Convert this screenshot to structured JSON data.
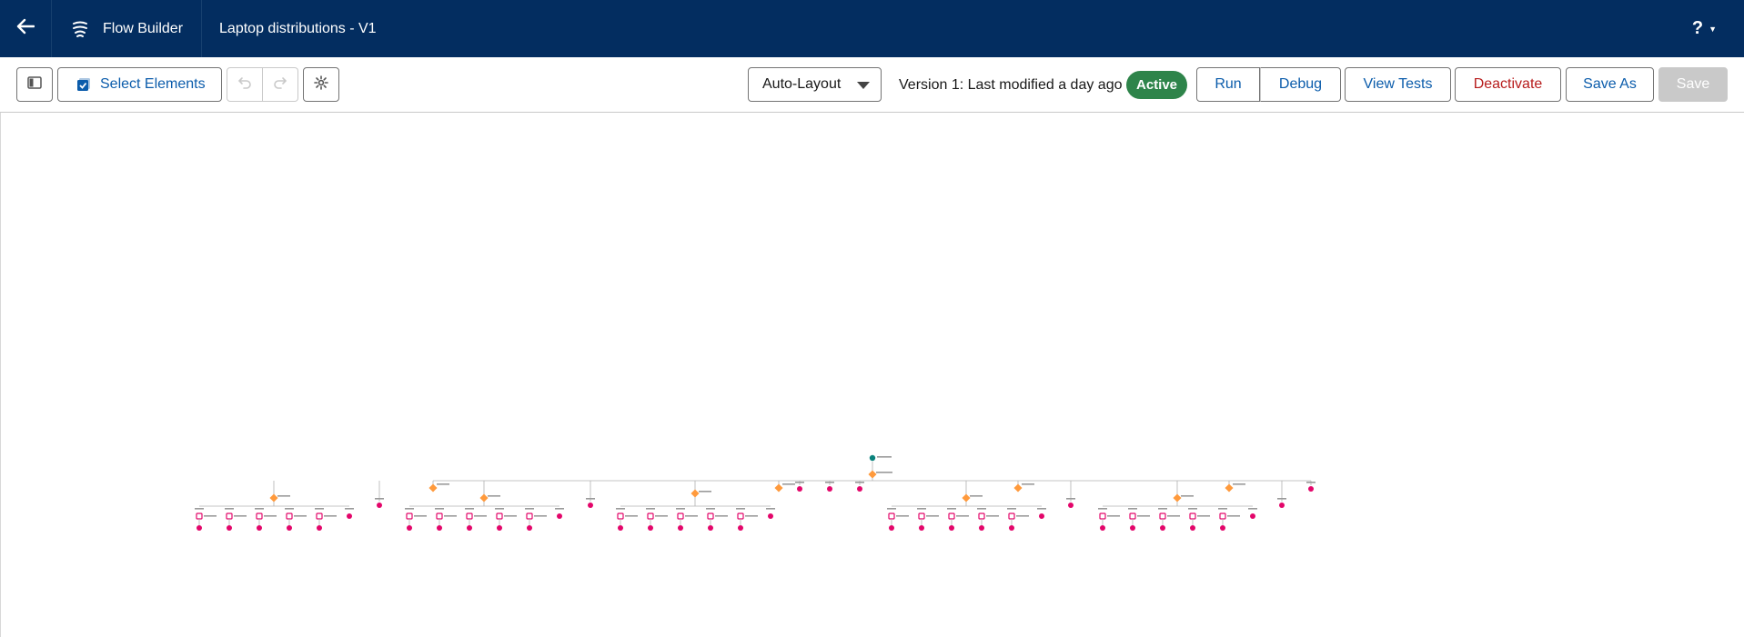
{
  "header": {
    "back_icon": "arrow-left-icon",
    "app_icon": "flow-icon",
    "app_name": "Flow Builder",
    "flow_title": "Laptop distributions - V1",
    "help_label": "?",
    "help_caret": "▼"
  },
  "toolbar": {
    "toggle_panel_icon": "panel-toggle-icon",
    "select_elements_label": "Select Elements",
    "select_elements_icon": "checkbox-select-icon",
    "undo_icon": "undo-icon",
    "redo_icon": "redo-icon",
    "settings_icon": "gear-icon",
    "layout_value": "Auto-Layout",
    "version_text": "Version 1: Last modified a day ago",
    "status_badge": "Active",
    "run_label": "Run",
    "debug_label": "Debug",
    "view_tests_label": "View Tests",
    "deactivate_label": "Deactivate",
    "save_as_label": "Save As",
    "save_label": "Save"
  },
  "colors": {
    "header_bg": "#032d60",
    "link": "#0b5cab",
    "active_badge": "#2e844a",
    "deactivate_text": "#b71c1c",
    "start_node": "#0b827c",
    "decision_node": "#ff9a3c",
    "action_node": "#e3066a"
  },
  "flow_canvas": {
    "decision_groups": [
      {
        "actions": 5,
        "plain_ends": 1
      },
      {
        "actions": 5,
        "plain_ends": 1
      },
      {
        "actions": 5,
        "plain_ends": 1
      },
      {
        "actions": 5,
        "plain_ends": 1
      },
      {
        "actions": 5,
        "plain_ends": 1
      }
    ]
  }
}
